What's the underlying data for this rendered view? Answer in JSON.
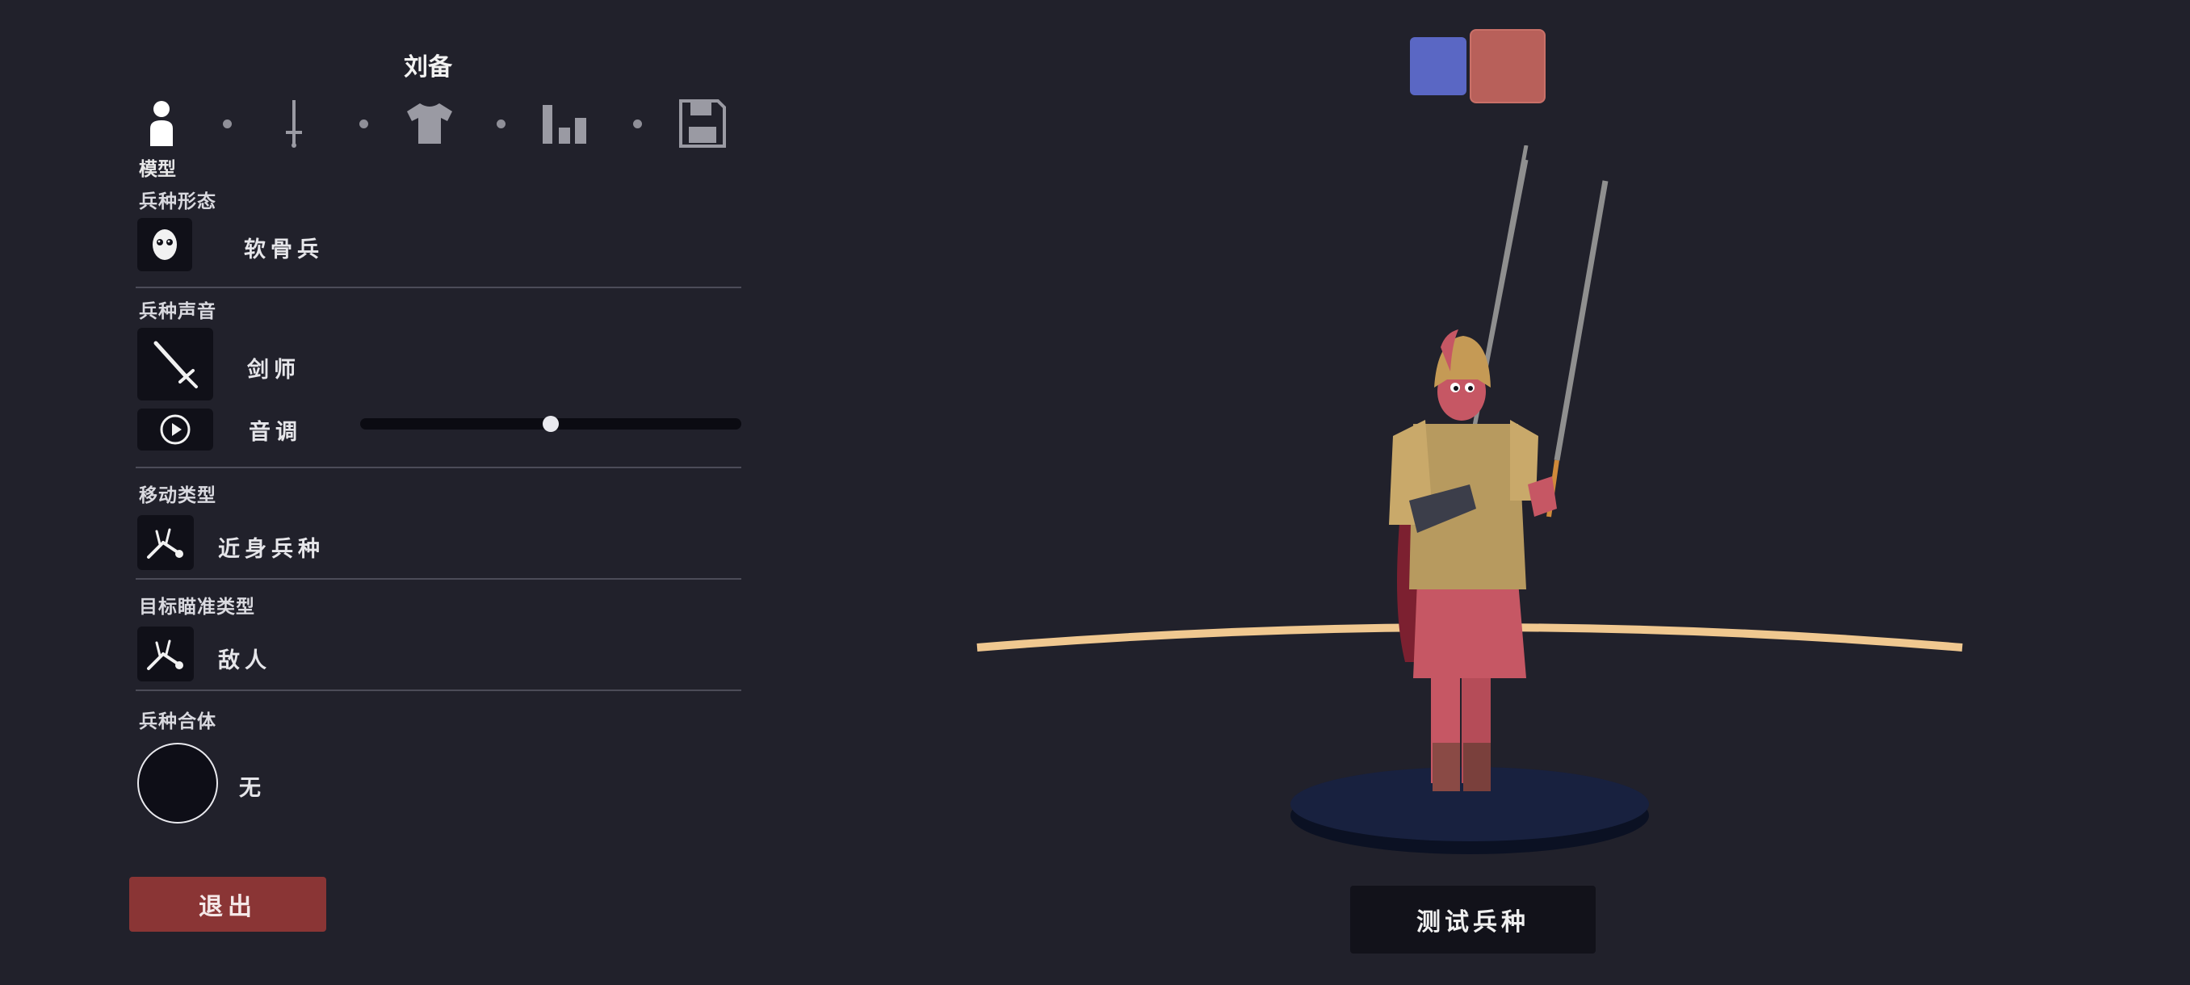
{
  "unit": {
    "name": "刘备"
  },
  "tabs": {
    "active_label": "模型",
    "items": [
      {
        "name": "model",
        "icon": "person-icon"
      },
      {
        "name": "weapons",
        "icon": "sword-icon"
      },
      {
        "name": "clothing",
        "icon": "shirt-icon"
      },
      {
        "name": "stats",
        "icon": "bar-chart-icon"
      },
      {
        "name": "save",
        "icon": "floppy-disk-icon"
      }
    ]
  },
  "sections": {
    "form": {
      "title": "兵种形态",
      "value": "软骨兵",
      "icon": "ragdoll-face-icon"
    },
    "voice": {
      "title": "兵种声音",
      "value": "剑师",
      "icon": "sword-icon",
      "pitch_label": "音调",
      "pitch_level": 0.5,
      "play_icon": "play-icon"
    },
    "movement": {
      "title": "移动类型",
      "value": "近身兵种",
      "icon": "melee-unit-icon"
    },
    "targeting": {
      "title": "目标瞄准类型",
      "value": "敌人",
      "icon": "target-unit-icon"
    },
    "combination": {
      "title": "兵种合体",
      "value": "无"
    }
  },
  "buttons": {
    "exit": "退出",
    "test": "测试兵种"
  },
  "team_colors": {
    "blue": "#5a67c4",
    "red": "#b8605a"
  }
}
